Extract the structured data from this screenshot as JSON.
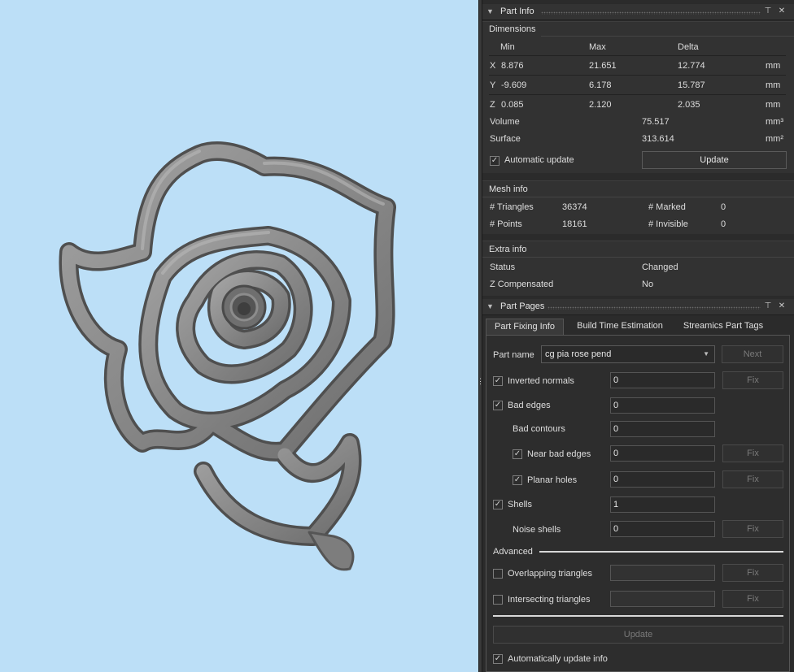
{
  "part_info": {
    "title": "Part Info",
    "dimensions": {
      "label": "Dimensions",
      "headers": {
        "min": "Min",
        "max": "Max",
        "delta": "Delta"
      },
      "rows": [
        {
          "axis": "X",
          "min": "8.876",
          "max": "21.651",
          "delta": "12.774",
          "unit": "mm"
        },
        {
          "axis": "Y",
          "min": "-9.609",
          "max": "6.178",
          "delta": "15.787",
          "unit": "mm"
        },
        {
          "axis": "Z",
          "min": "0.085",
          "max": "2.120",
          "delta": "2.035",
          "unit": "mm"
        }
      ],
      "volume_label": "Volume",
      "volume_value": "75.517",
      "volume_unit": "mm³",
      "surface_label": "Surface",
      "surface_value": "313.614",
      "surface_unit": "mm²",
      "auto_update_label": "Automatic update",
      "update_button": "Update"
    },
    "mesh_info": {
      "label": "Mesh info",
      "triangles_label": "# Triangles",
      "triangles_value": "36374",
      "points_label": "# Points",
      "points_value": "18161",
      "marked_label": "# Marked",
      "marked_value": "0",
      "invisible_label": "# Invisible",
      "invisible_value": "0"
    },
    "extra_info": {
      "label": "Extra info",
      "status_label": "Status",
      "status_value": "Changed",
      "zcomp_label": "Z Compensated",
      "zcomp_value": "No"
    }
  },
  "part_pages": {
    "title": "Part Pages",
    "tabs": [
      "Part Fixing Info",
      "Build Time Estimation",
      "Streamics Part Tags"
    ],
    "part_name_label": "Part name",
    "part_name_value": "cg pia rose pend",
    "next_button": "Next",
    "fix_label": "Fix",
    "rows": {
      "inverted_normals": {
        "label": "Inverted normals",
        "value": "0"
      },
      "bad_edges": {
        "label": "Bad edges",
        "value": "0"
      },
      "bad_contours": {
        "label": "Bad contours",
        "value": "0"
      },
      "near_bad_edges": {
        "label": "Near bad edges",
        "value": "0"
      },
      "planar_holes": {
        "label": "Planar holes",
        "value": "0"
      },
      "shells": {
        "label": "Shells",
        "value": "1"
      },
      "noise_shells": {
        "label": "Noise shells",
        "value": "0"
      }
    },
    "advanced_label": "Advanced",
    "overlapping_label": "Overlapping triangles",
    "intersecting_label": "Intersecting triangles",
    "update_button": "Update",
    "auto_update_info_label": "Automatically update info"
  },
  "icons": {
    "collapse": "triangle-down-icon",
    "pin": "pin-icon",
    "close": "close-icon",
    "check": "checkmark-icon"
  },
  "colors": {
    "viewport_bg": "#bcdff7",
    "model": "#8a8a8a",
    "panel_bg": "#2b2b2b"
  }
}
